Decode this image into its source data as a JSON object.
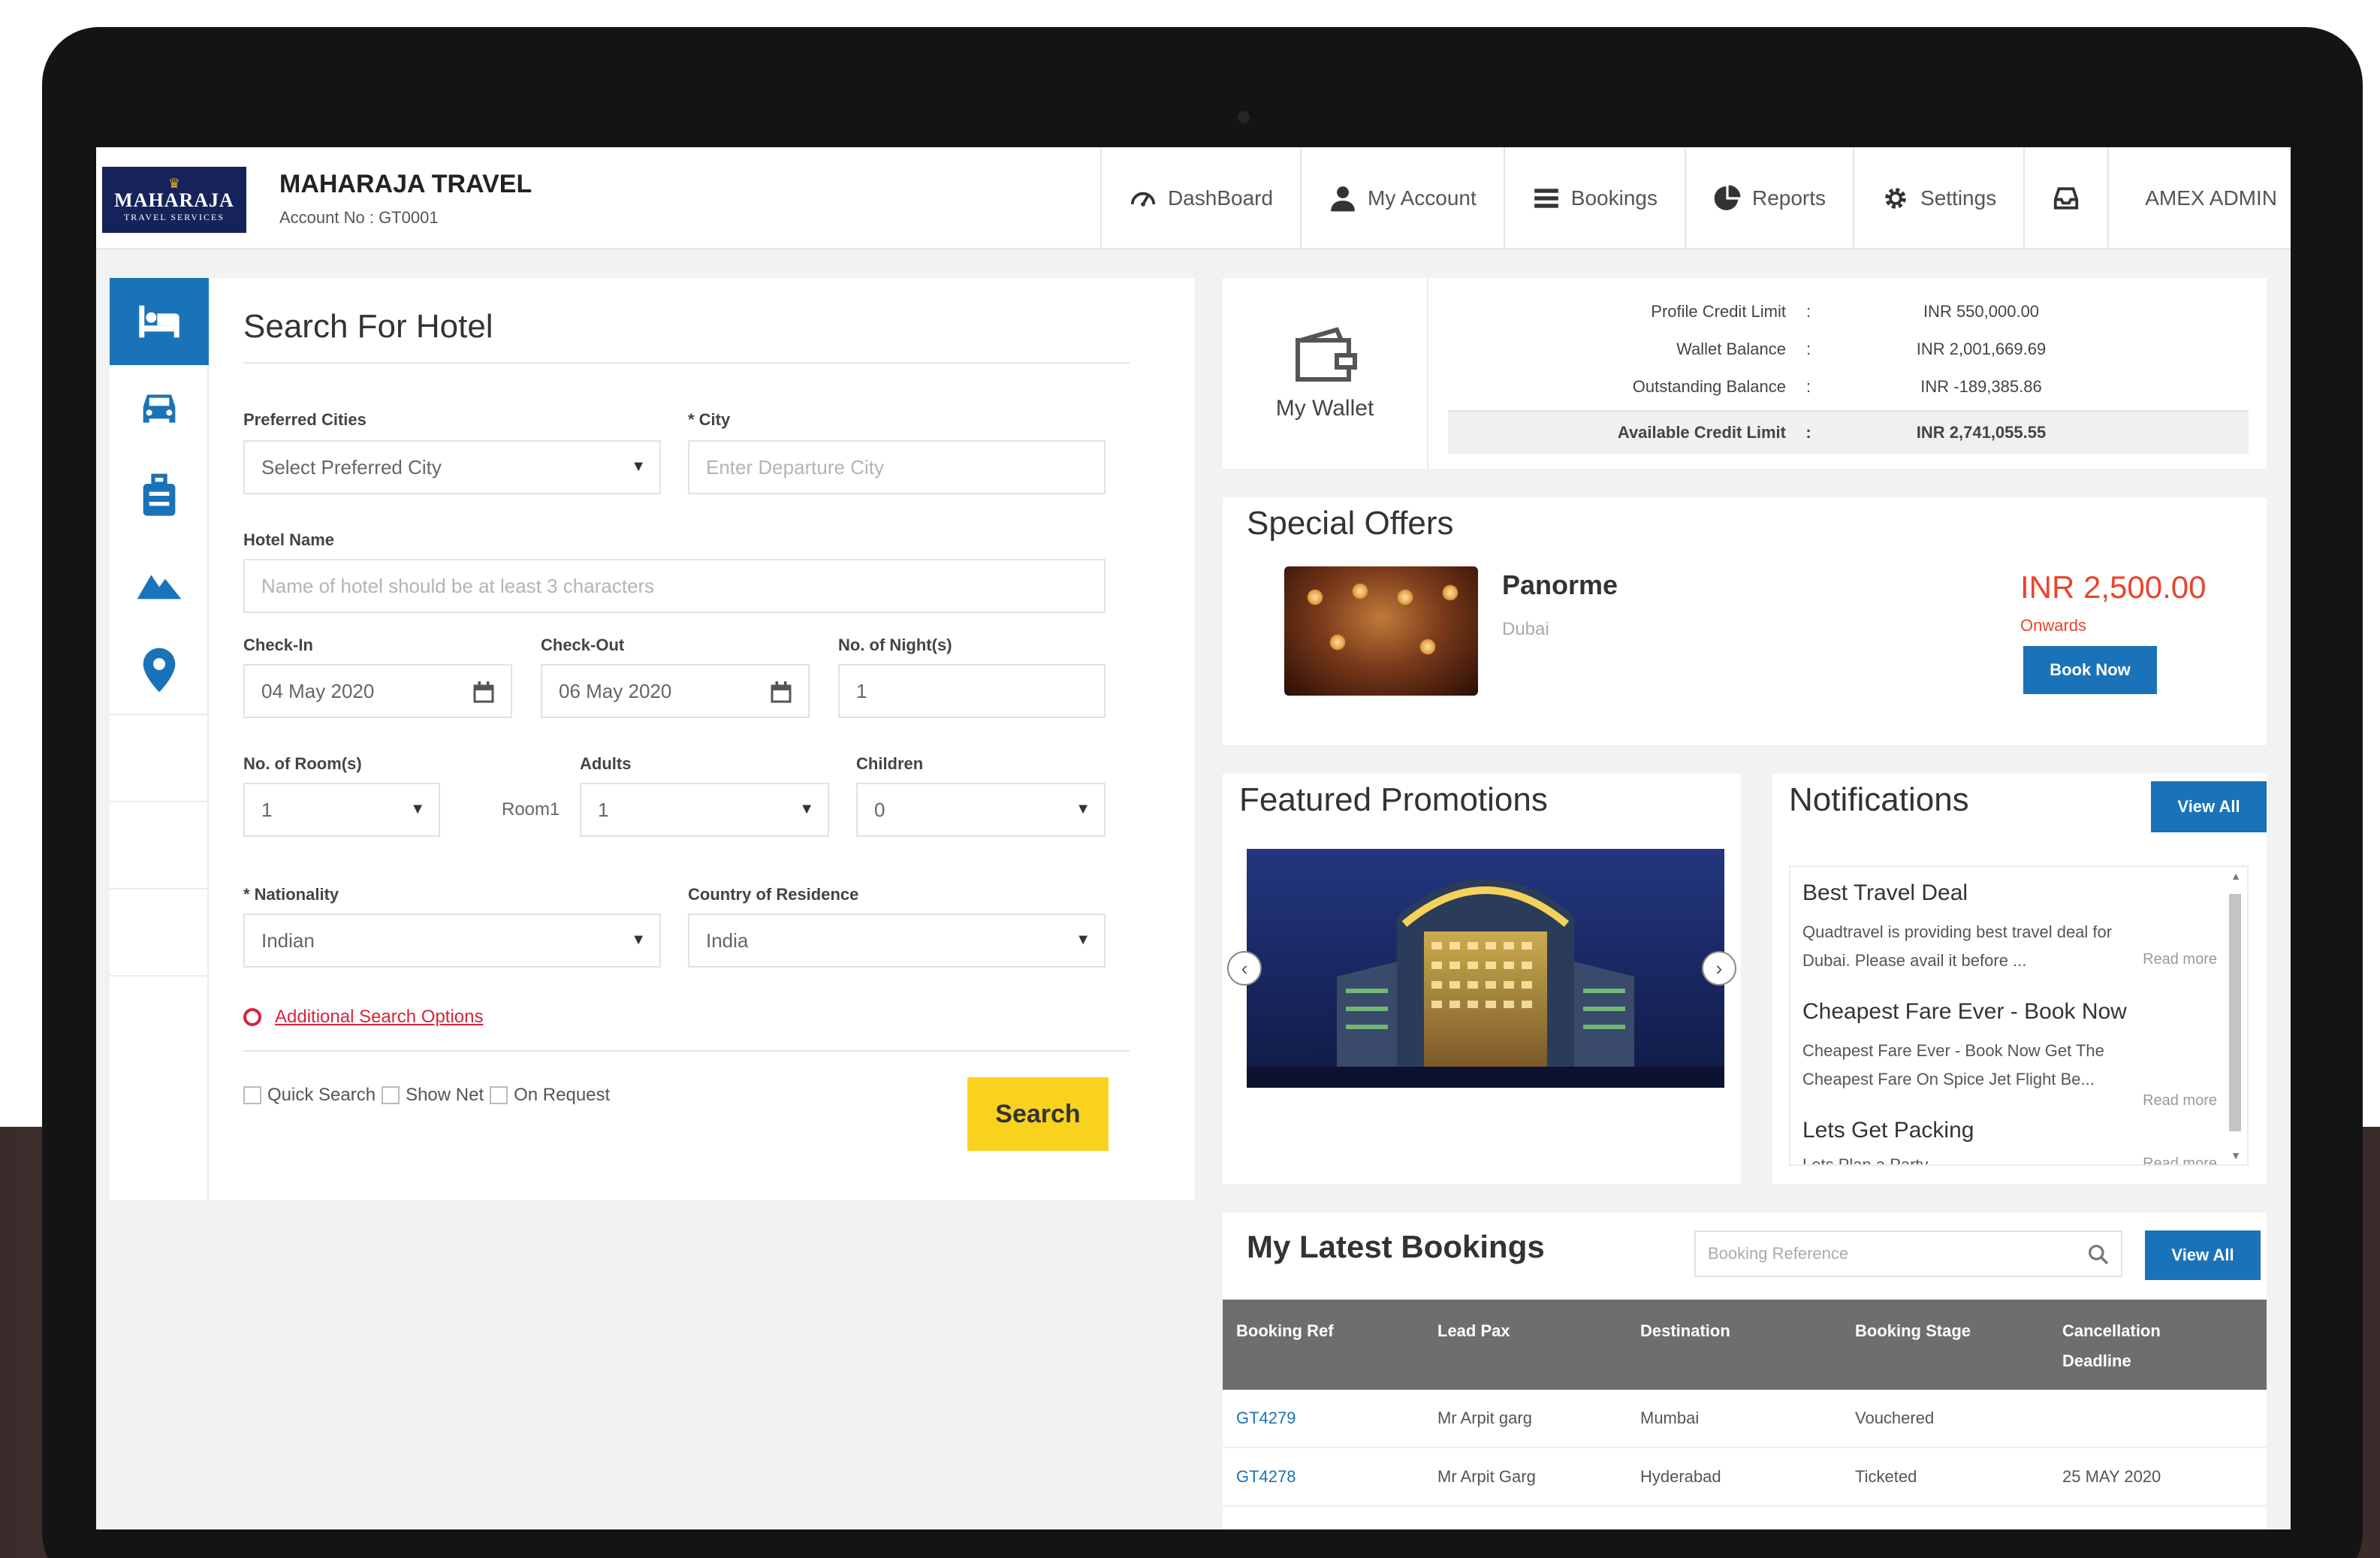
{
  "brand": {
    "logo_line1": "MAHARAJA",
    "logo_line2": "TRAVEL SERVICES",
    "name": "MAHARAJA TRAVEL",
    "account": "Account No : GT0001"
  },
  "nav": [
    {
      "label": "DashBoard",
      "icon": "dashboard-gauge"
    },
    {
      "label": "My Account",
      "icon": "user"
    },
    {
      "label": "Bookings",
      "icon": "menu-lines"
    },
    {
      "label": "Reports",
      "icon": "pie-chart"
    },
    {
      "label": "Settings",
      "icon": "gear"
    },
    {
      "label": "",
      "icon": "inbox"
    }
  ],
  "user": "AMEX ADMIN",
  "sidebar": [
    "hotel-bed",
    "car",
    "luggage",
    "mountains",
    "location-pin"
  ],
  "search_form": {
    "title": "Search For Hotel",
    "preferred_cities_label": "Preferred Cities",
    "preferred_cities_value": "Select Preferred City",
    "city_label": "* City",
    "city_placeholder": "Enter Departure City",
    "hotel_name_label": "Hotel Name",
    "hotel_name_placeholder": "Name of hotel should be at least 3 characters",
    "checkin_label": "Check-In",
    "checkin_value": "04 May 2020",
    "checkout_label": "Check-Out",
    "checkout_value": "06 May 2020",
    "nights_label": "No. of Night(s)",
    "nights_value": "1",
    "rooms_label": "No. of Room(s)",
    "rooms_value": "1",
    "room_text": "Room1",
    "adults_label": "Adults",
    "adults_value": "1",
    "children_label": "Children",
    "children_value": "0",
    "nationality_label": "* Nationality",
    "nationality_value": "Indian",
    "residence_label": "Country of Residence",
    "residence_value": "India",
    "advanced_link": "Additional Search Options",
    "quick_search": "Quick Search",
    "show_net": "Show Net",
    "on_request": "On Request",
    "search_button": "Search"
  },
  "wallet": {
    "label": "My Wallet",
    "rows": [
      {
        "key": "Profile Credit Limit",
        "sep": ":",
        "value": "INR 550,000.00"
      },
      {
        "key": "Wallet Balance",
        "sep": ":",
        "value": "INR 2,001,669.69"
      },
      {
        "key": "Outstanding Balance",
        "sep": ":",
        "value": "INR -189,385.86"
      },
      {
        "key": "Available Credit Limit",
        "sep": ":",
        "value": "INR 2,741,055.55"
      }
    ]
  },
  "special_offers": {
    "title": "Special Offers",
    "name": "Panorme",
    "location": "Dubai",
    "price": "INR 2,500.00",
    "price_suffix": "Onwards",
    "button": "Book Now"
  },
  "featured": {
    "title": "Featured Promotions"
  },
  "notifications": {
    "title": "Notifications",
    "view_all": "View All",
    "items": [
      {
        "title": "Best Travel Deal",
        "line1": "Quadtravel is providing best travel deal for",
        "line2": "Dubai. Please avail it before ...",
        "more": "Read more"
      },
      {
        "title": "Cheapest Fare Ever - Book Now",
        "line1": "Cheapest Fare Ever - Book Now Get The",
        "line2": "Cheapest Fare On Spice Jet Flight Be...",
        "more": "Read more"
      },
      {
        "title": "Lets Get Packing",
        "line1": "Lets Plan a Party",
        "line2": "",
        "more": "Read more"
      }
    ]
  },
  "bookings": {
    "title": "My Latest Bookings",
    "search_placeholder": "Booking Reference",
    "view_all": "View All",
    "headers": [
      "Booking Ref",
      "Lead Pax",
      "Destination",
      "Booking Stage",
      "Cancellation Deadline"
    ],
    "rows": [
      [
        "GT4279",
        "Mr Arpit garg",
        "Mumbai",
        "Vouchered",
        ""
      ],
      [
        "GT4278",
        "Mr Arpit Garg",
        "Hyderabad",
        "Ticketed",
        "25 MAY 2020"
      ]
    ]
  },
  "colors": {
    "primary": "#1a73b8",
    "accent": "#f9d21d",
    "price": "#e8452c",
    "logo_bg": "#15235a"
  }
}
